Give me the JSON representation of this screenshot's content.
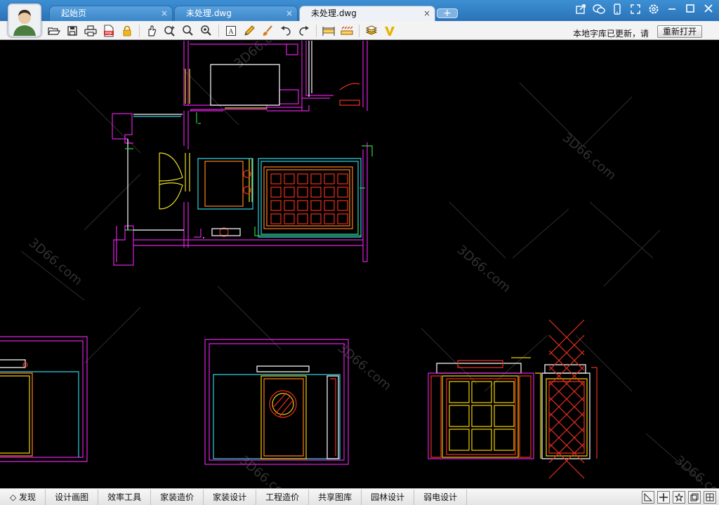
{
  "tabs": [
    {
      "label": "起始页",
      "active": false
    },
    {
      "label": "未处理.dwg",
      "active": false
    },
    {
      "label": "未处理.dwg",
      "active": true
    }
  ],
  "tab_close_glyph": "×",
  "tab_add_glyph": "+",
  "window_controls": [
    "share-icon",
    "chat-icon",
    "mobile-icon",
    "fullscreen-icon",
    "settings-icon",
    "minimize-icon",
    "maximize-icon",
    "close-icon"
  ],
  "toolbar": {
    "tools": [
      "open-icon",
      "save-icon",
      "print-icon",
      "pdf-icon",
      "lock-icon",
      "pan-icon",
      "zoom-in-icon",
      "zoom-window-icon",
      "zoom-extent-icon",
      "text-icon",
      "pencil-icon",
      "brush-icon",
      "undo-icon",
      "redo-icon",
      "measure-icon",
      "dimension-icon",
      "layers-icon",
      "v-icon"
    ],
    "notice": "本地字库已更新，请",
    "reopen_label": "重新打开"
  },
  "bottom_tabs": [
    "发现",
    "设计画图",
    "效率工具",
    "家装造价",
    "家装设计",
    "工程造价",
    "共享图库",
    "园林设计",
    "弱电设计"
  ],
  "bottom_icons": [
    "model-icon",
    "crosshair-icon",
    "star-icon",
    "layout-icon",
    "layout-2-icon"
  ],
  "watermark": "3D66.com",
  "colors": {
    "title_bar": "#2f7ec4",
    "canvas": "#000000",
    "cad_magenta": "#e020e0",
    "cad_red": "#e83020",
    "cad_yellow": "#f0d000",
    "cad_white": "#ffffff",
    "cad_cyan": "#30d0e0",
    "cad_green": "#30d040",
    "cad_orange": "#ff8020"
  }
}
